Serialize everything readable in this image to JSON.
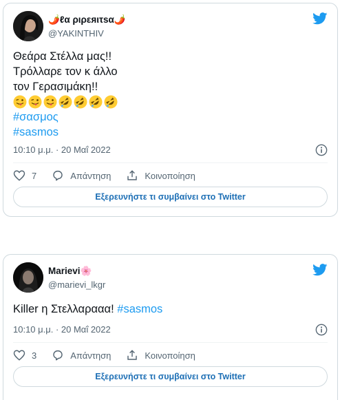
{
  "colors": {
    "twitter_blue": "#1d9bf0",
    "text": "#0f1419",
    "secondary": "#536471",
    "border": "#cfd9de"
  },
  "tweets": [
    {
      "display_name": "🌶️ℓα ριρεяιτѕα🌶️",
      "handle": "@YAKINTHIV",
      "text_lines": [
        "Θεάρα Στέλλα μας!!",
        "Τρόλλαρε τον κ άλλο",
        "τον Γερασιμάκη!!"
      ],
      "emoji_icons": [
        "winking-tongue-emoji",
        "winking-tongue-emoji",
        "winking-tongue-emoji",
        "rofl-emoji",
        "rofl-emoji",
        "rofl-emoji",
        "rofl-emoji"
      ],
      "hashtags": [
        "#σασμος",
        "#sasmos"
      ],
      "timestamp": "10:10 μ.μ. · 20 Μαΐ 2022",
      "likes": "7",
      "reply_label": "Απάντηση",
      "share_label": "Κοινοποίηση",
      "explore_label": "Εξερευνήστε τι συμβαίνει στο Twitter"
    },
    {
      "display_name": "Marievi🌸",
      "handle": "@marievi_lkgr",
      "text": "Killer η Στελλαρααα!",
      "hashtag": "#sasmos",
      "timestamp": "10:10 μ.μ. · 20 Μαΐ 2022",
      "likes": "3",
      "reply_label": "Απάντηση",
      "share_label": "Κοινοποίηση",
      "explore_label": "Εξερευνήστε τι συμβαίνει στο Twitter"
    }
  ]
}
